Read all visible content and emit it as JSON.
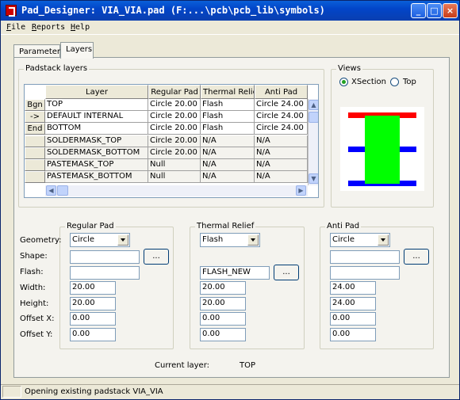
{
  "window": {
    "title": "Pad_Designer: VIA_VIA.pad (F:...\\pcb\\pcb_lib\\symbols)"
  },
  "menu": [
    "File",
    "Reports",
    "Help"
  ],
  "tabs": [
    {
      "label": "Parameters",
      "active": false
    },
    {
      "label": "Layers",
      "active": true
    }
  ],
  "padstack": {
    "group_label": "Padstack layers",
    "columns": [
      "Layer",
      "Regular Pad",
      "Thermal Relief",
      "Anti Pad"
    ],
    "row_buttons": [
      "Bgn",
      "->",
      "End",
      "",
      "",
      ""
    ],
    "rows": [
      [
        "TOP",
        "Circle 20.00",
        "Flash",
        "Circle 24.00"
      ],
      [
        "DEFAULT INTERNAL",
        "Circle 20.00",
        "Flash",
        "Circle 24.00"
      ],
      [
        "BOTTOM",
        "Circle 20.00",
        "Flash",
        "Circle 24.00"
      ],
      [
        "SOLDERMASK_TOP",
        "Circle 20.00",
        "N/A",
        "N/A"
      ],
      [
        "SOLDERMASK_BOTTOM",
        "Circle 20.00",
        "N/A",
        "N/A"
      ],
      [
        "PASTEMASK_TOP",
        "Null",
        "N/A",
        "N/A"
      ],
      [
        "PASTEMASK_BOTTOM",
        "Null",
        "N/A",
        "N/A"
      ]
    ]
  },
  "views": {
    "group_label": "Views",
    "options": [
      "XSection",
      "Top"
    ],
    "selected": "XSection",
    "colors": {
      "top": "#ff0000",
      "inner": "#0000ff",
      "bottom": "#0000ff",
      "drill": "#00ff00"
    }
  },
  "labels": {
    "geometry": "Geometry:",
    "shape": "Shape:",
    "flash": "Flash:",
    "width": "Width:",
    "height": "Height:",
    "offset_x": "Offset X:",
    "offset_y": "Offset Y:"
  },
  "regular": {
    "label": "Regular Pad",
    "geometry": "Circle",
    "shape": "",
    "flash": "",
    "width": "20.00",
    "height": "20.00",
    "offset_x": "0.00",
    "offset_y": "0.00"
  },
  "thermal": {
    "label": "Thermal Relief",
    "geometry": "Flash",
    "flash": "FLASH_NEW",
    "width": "20.00",
    "height": "20.00",
    "offset_x": "0.00",
    "offset_y": "0.00"
  },
  "anti": {
    "label": "Anti Pad",
    "geometry": "Circle",
    "shape": "",
    "flash": "",
    "width": "24.00",
    "height": "24.00",
    "offset_x": "0.00",
    "offset_y": "0.00"
  },
  "browse": "...",
  "current_layer": {
    "label": "Current layer:",
    "value": "TOP"
  },
  "status": "Opening existing padstack VIA_VIA"
}
